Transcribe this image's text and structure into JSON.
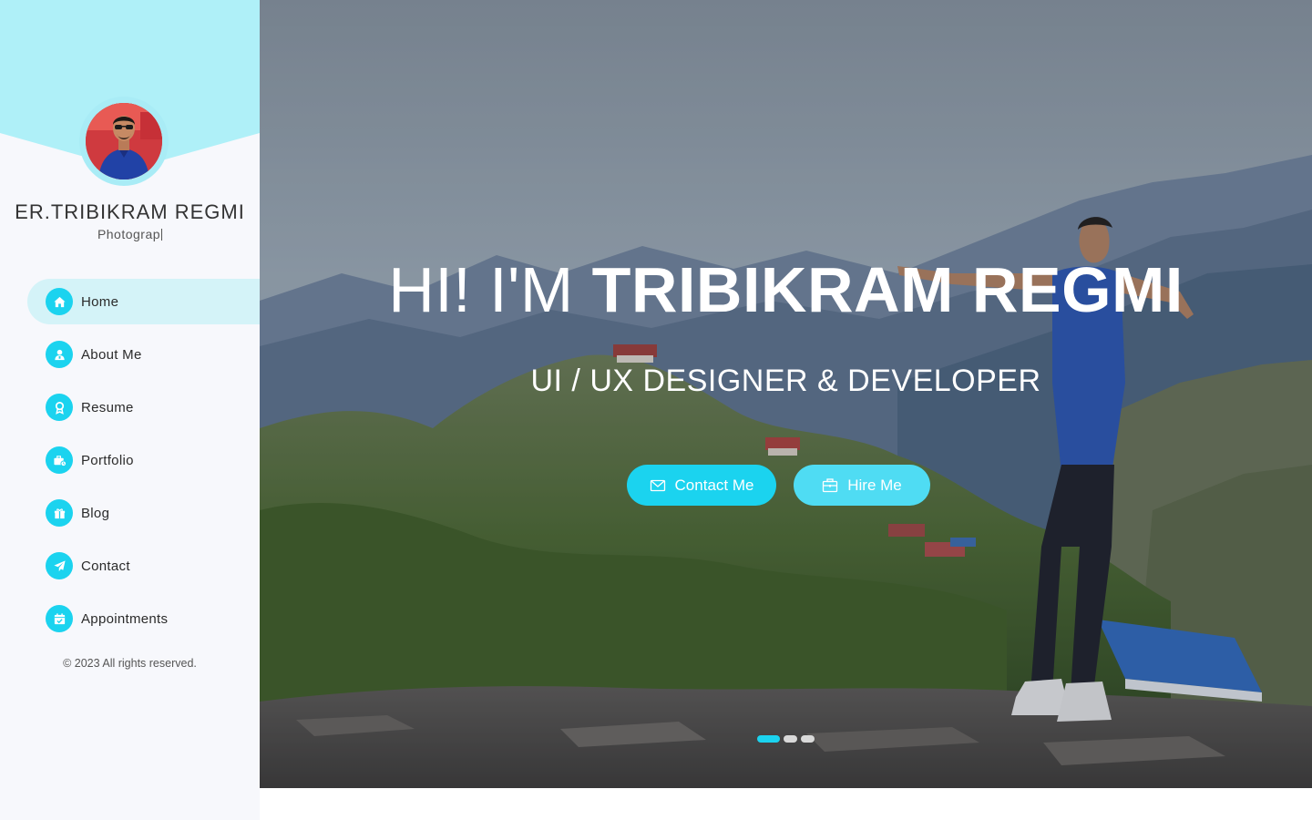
{
  "profile": {
    "name": "ER.TRIBIKRAM REGMI",
    "role": "Photograp"
  },
  "nav": {
    "items": [
      {
        "label": "Home",
        "icon": "home-icon",
        "active": true
      },
      {
        "label": "About Me",
        "icon": "user-icon",
        "active": false
      },
      {
        "label": "Resume",
        "icon": "award-icon",
        "active": false
      },
      {
        "label": "Portfolio",
        "icon": "briefcase-icon",
        "active": false
      },
      {
        "label": "Blog",
        "icon": "gift-icon",
        "active": false
      },
      {
        "label": "Contact",
        "icon": "paper-plane-icon",
        "active": false
      },
      {
        "label": "Appointments",
        "icon": "calendar-check-icon",
        "active": false
      }
    ]
  },
  "footer": {
    "copyright": "© 2023 All rights reserved."
  },
  "hero": {
    "greeting": "HI! I'M",
    "name": "TRIBIKRAM REGMI",
    "subtitle": "UI / UX DESIGNER & DEVELOPER",
    "contact_label": "Contact Me",
    "hire_label": "Hire Me",
    "slides": 3,
    "active_slide": 1
  },
  "colors": {
    "accent": "#1bd3ef",
    "accent_light": "#a9ecf6",
    "active_nav_bg": "#d4f3f8",
    "sidebar_bg": "#f7f8fc"
  }
}
